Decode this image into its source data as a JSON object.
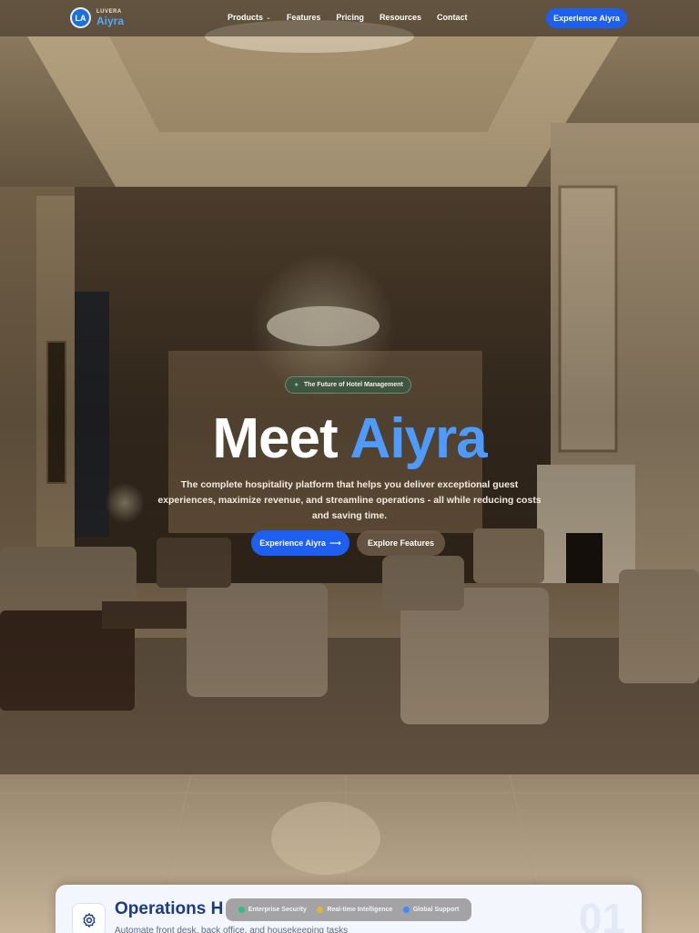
{
  "colors": {
    "accent": "#1d5ff0",
    "title_blue": "#4e9bff",
    "badge_green": "#4fe08f",
    "card_title": "#1b3a8a"
  },
  "nav": {
    "logo_badge": "LA",
    "logo_small": "LUVERA",
    "logo_name": "Aiyra",
    "menu": [
      {
        "label": "Products",
        "icon": "chevron-down-icon"
      },
      {
        "label": "Features"
      },
      {
        "label": "Pricing"
      },
      {
        "label": "Resources"
      },
      {
        "label": "Contact"
      }
    ],
    "cta": "Experience Aiyra"
  },
  "hero": {
    "badge_icon": "sparkle-icon",
    "badge": "The Future of Hotel Management",
    "title_part1": "Meet",
    "title_part2": "Aiyra",
    "subtitle": "The complete hospitality platform that helps you deliver exceptional guest experiences, maximize revenue, and streamline operations - all while reducing costs and saving time.",
    "primary_button": "Experience Aiyra",
    "primary_icon": "arrow-right-icon",
    "secondary_button": "Explore Features"
  },
  "card": {
    "icon": "gear-icon",
    "title": "Operations H",
    "description": "Automate front desk, back office, and housekeeping tasks",
    "number": "01"
  },
  "trust_bar": [
    {
      "label": "Enterprise Security",
      "color": "#2fbf86"
    },
    {
      "label": "Real-time Intelligence",
      "color": "#e0b43a"
    },
    {
      "label": "Global Support",
      "color": "#3d8bff"
    }
  ]
}
